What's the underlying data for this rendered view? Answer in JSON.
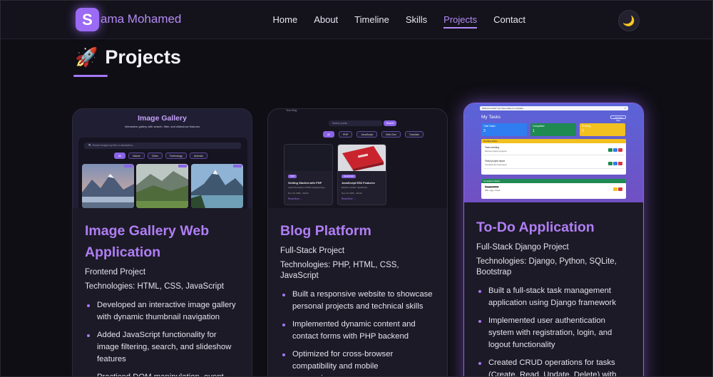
{
  "header": {
    "logo_letter": "S",
    "logo_rest": "ama Mohamed",
    "nav": [
      "Home",
      "About",
      "Timeline",
      "Skills",
      "Projects",
      "Contact"
    ],
    "active_nav": "Projects",
    "theme_icon": "moon-icon"
  },
  "section": {
    "icon": "rocket-icon",
    "title": "Projects"
  },
  "colors": {
    "accent": "#b07ef5",
    "background": "#0f0e14",
    "card": "#1c1a26"
  },
  "cards": [
    {
      "title": "Image Gallery Web Application",
      "subtitle": "Frontend Project",
      "tech": "Technologies: HTML, CSS, JavaScript",
      "bullets": [
        "Developed an interactive image gallery with dynamic thumbnail navigation",
        "Added JavaScript functionality for image filtering, search, and slideshow features",
        "Practiced DOM manipulation, event"
      ],
      "preview": {
        "title": "Image Gallery",
        "subtitle": "Interactive gallery with search, filter, and slideshow features",
        "search_placeholder": "Search images by title or description...",
        "filters": [
          "All",
          "Nature",
          "Cities",
          "Technology",
          "Animals"
        ]
      }
    },
    {
      "title": "Blog Platform",
      "subtitle": "Full-Stack Project",
      "tech": "Technologies: PHP, HTML, CSS, JavaScript",
      "bullets": [
        "Built a responsive website to showcase personal projects and technical skills",
        "Implemented dynamic content and contact forms with PHP backend",
        "Optimized for cross-browser compatibility and mobile responsiveness"
      ],
      "preview": {
        "cut_text": "Tech Blog",
        "search_placeholder": "Search posts...",
        "search_button": "Search",
        "filters": [
          "All",
          "PHP",
          "JavaScript",
          "Web Dev",
          "Tutorials"
        ],
        "posts": [
          {
            "cat": "PHP",
            "title": "Getting Started with PHP",
            "excerpt": "Learn the basics of PHP programming...",
            "meta": "Nov 15, 2024 · Admin",
            "more": "Read More →"
          },
          {
            "cat": "JavaScript",
            "title": "JavaScript ES6 Features",
            "excerpt": "Explore modern JavaScript...",
            "meta": "Nov 10, 2024 · Admin",
            "more": "Read More →"
          }
        ]
      }
    },
    {
      "title": "To-Do Application",
      "subtitle": "Full-Stack Django Project",
      "tech": "Technologies: Django, Python, SQLite, Bootstrap",
      "bullets": [
        "Built a full-stack task management application using Django framework",
        "Implemented user authentication system with registration, login, and logout functionality",
        "Created CRUD operations for tasks (Create, Read, Update, Delete) with"
      ],
      "preview": {
        "topbar": "Welcome back! You have tasks to complete.",
        "heading": "My Tasks",
        "add_button": "+ Add New Task",
        "stats": [
          {
            "label": "Total Tasks",
            "value": "3"
          },
          {
            "label": "Completed",
            "value": "1"
          },
          {
            "label": "Pending",
            "value": "2"
          }
        ],
        "pending_header": "Pending Tasks",
        "completed_header": "Completed Tasks",
        "tasks": [
          {
            "title": "Team meeting",
            "detail": "Discuss project progress"
          },
          {
            "title": "Finish project report",
            "detail": "Complete the final report"
          },
          {
            "title": "Buy groceries",
            "detail": "Milk, eggs, bread"
          }
        ]
      }
    }
  ]
}
